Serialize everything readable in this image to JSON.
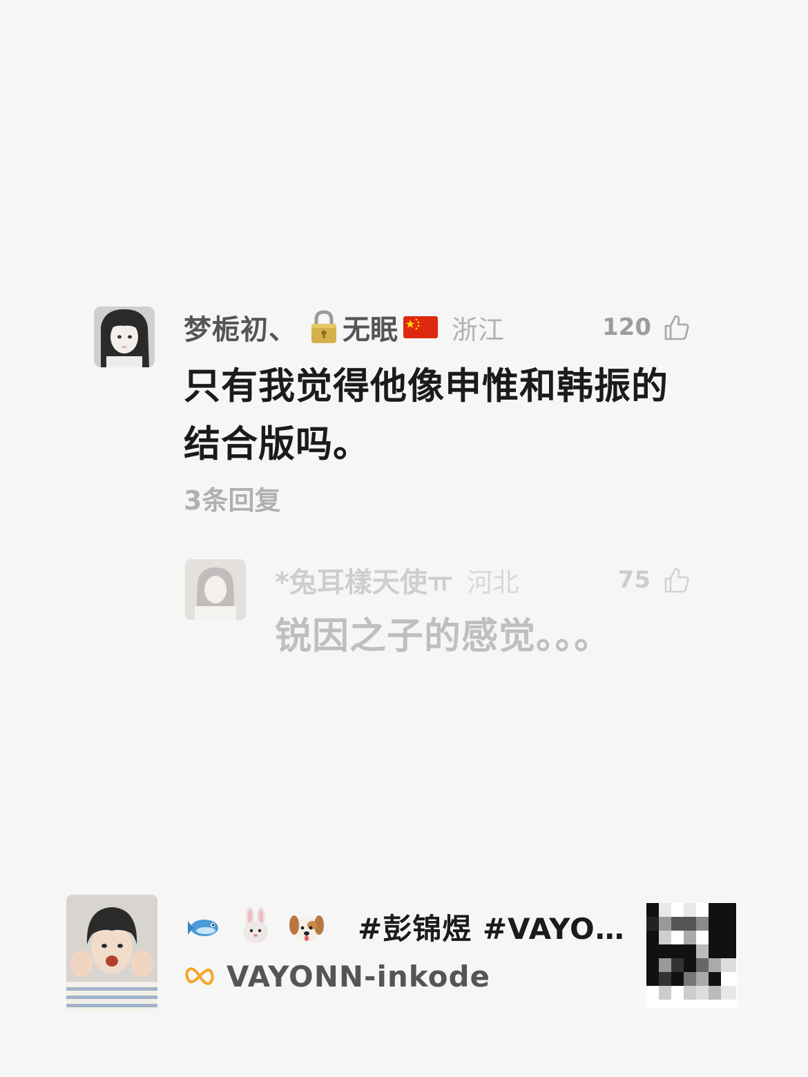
{
  "comment": {
    "username": "梦栀初、",
    "username_suffix": "无眠",
    "lock_icon": "lock-icon",
    "flag_icon": "china-flag-icon",
    "location": "浙江",
    "like_count": "120",
    "text": "只有我觉得他像申惟和韩振的结合版吗。",
    "reply_count": "3条回复"
  },
  "reply": {
    "username": "*兔耳樣天使ㅠ",
    "location": "河北",
    "like_count": "75",
    "text": "锐因之子的感觉。。。"
  },
  "post": {
    "emojis": [
      "fish-icon",
      "rabbit-icon",
      "dog-icon"
    ],
    "title": "#彭锦煜 #VAYO…",
    "author": "VAYONN-inkode",
    "brand_icon": "infinity-brand-icon"
  },
  "colors": {
    "background": "#f6f6f6",
    "primary_text": "#1b1b1b",
    "secondary_text": "#555555",
    "muted_text": "#b0b0b0",
    "brand_orange": "#f5a623"
  }
}
